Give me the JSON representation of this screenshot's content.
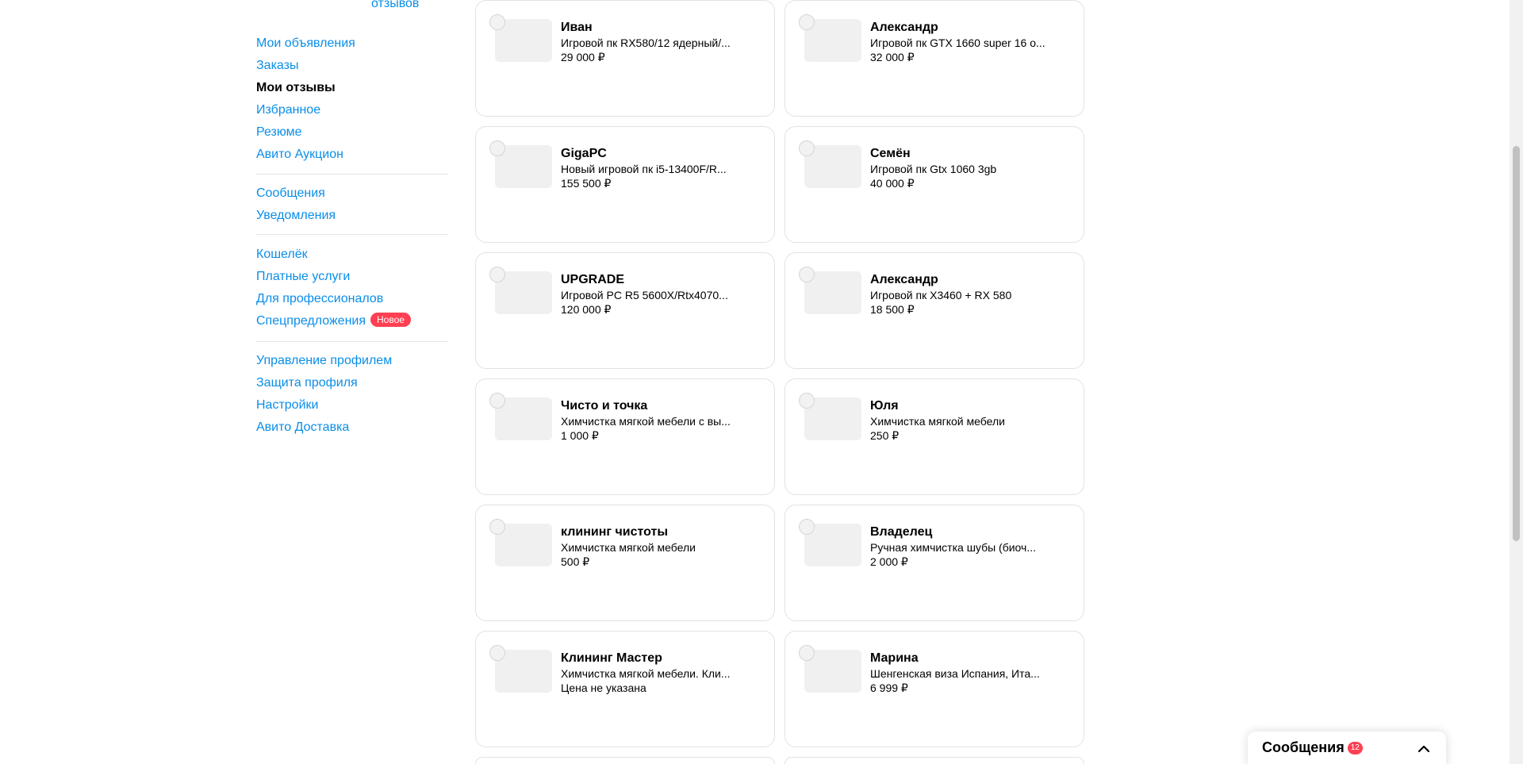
{
  "sidebar": {
    "reviews_link": "отзывов",
    "groups": [
      {
        "items": [
          {
            "label": "Мои объявления",
            "active": false
          },
          {
            "label": "Заказы",
            "active": false
          },
          {
            "label": "Мои отзывы",
            "active": true
          },
          {
            "label": "Избранное",
            "active": false
          },
          {
            "label": "Резюме",
            "active": false
          },
          {
            "label": "Авито Аукцион",
            "active": false
          }
        ]
      },
      {
        "items": [
          {
            "label": "Сообщения",
            "active": false
          },
          {
            "label": "Уведомления",
            "active": false
          }
        ]
      },
      {
        "items": [
          {
            "label": "Кошелёк",
            "active": false
          },
          {
            "label": "Платные услуги",
            "active": false
          },
          {
            "label": "Для профессионалов",
            "active": false
          },
          {
            "label": "Спецпредложения",
            "active": false,
            "badge": "Новое"
          }
        ]
      },
      {
        "items": [
          {
            "label": "Управление профилем",
            "active": false
          },
          {
            "label": "Защита профиля",
            "active": false
          },
          {
            "label": "Настройки",
            "active": false
          },
          {
            "label": "Авито Доставка",
            "active": false
          }
        ]
      }
    ]
  },
  "cards": [
    {
      "name": "Иван",
      "desc": "Игровой пк RX580/12 ядерный/...",
      "price": "29 000 ₽"
    },
    {
      "name": "Александр",
      "desc": "Игровой пк GTX 1660 super 16 о...",
      "price": "32 000 ₽"
    },
    {
      "name": "GigaPC",
      "desc": "Новый игровой пк i5-13400F/R...",
      "price": "155 500 ₽"
    },
    {
      "name": "Семён",
      "desc": "Игровой пк Gtx 1060 3gb",
      "price": "40 000 ₽"
    },
    {
      "name": "UPGRADE",
      "desc": "Игровой PC R5 5600X/Rtx4070...",
      "price": "120 000 ₽"
    },
    {
      "name": "Александр",
      "desc": "Игровой пк X3460 + RX 580",
      "price": "18 500 ₽"
    },
    {
      "name": "Чисто и точка",
      "desc": "Химчистка мягкой мебели с вы...",
      "price": "1 000 ₽"
    },
    {
      "name": "Юля",
      "desc": "Химчистка мягкой мебели",
      "price": "250 ₽"
    },
    {
      "name": "клининг чистоты",
      "desc": "Химчистка мягкой мебели",
      "price": "500 ₽"
    },
    {
      "name": "Владелец",
      "desc": "Ручная химчистка шубы (биоч...",
      "price": "2 000 ₽"
    },
    {
      "name": "Клининг Мастер",
      "desc": "Химчистка мягкой мебели. Кли...",
      "price": "Цена не указана"
    },
    {
      "name": "Марина",
      "desc": "Шенгенская виза Испания, Ита...",
      "price": "6 999 ₽"
    }
  ],
  "messenger": {
    "title": "Сообщения",
    "count": "12",
    "icon": "chevron-up-icon"
  },
  "colors": {
    "link": "#0a8ee8",
    "badge": "#ff4053",
    "border": "#e2e2e2"
  }
}
